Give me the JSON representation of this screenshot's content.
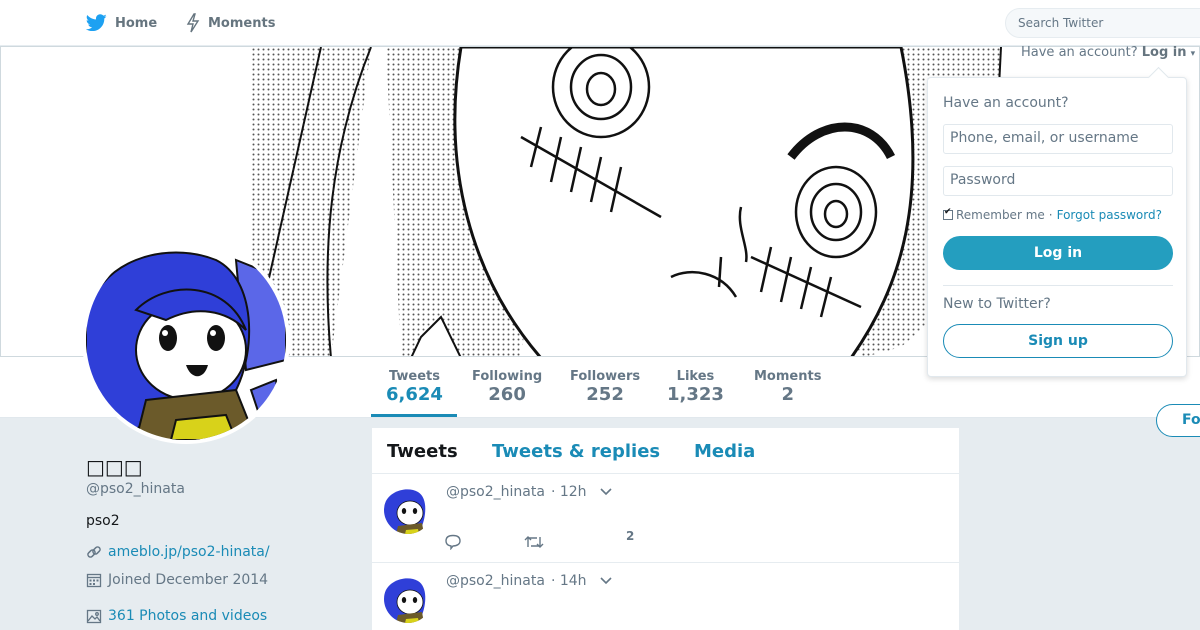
{
  "nav": {
    "home_label": "Home",
    "moments_label": "Moments",
    "search_placeholder": "Search Twitter"
  },
  "login": {
    "toggle_prefix": "Have an account?",
    "toggle_label": "Log in",
    "panel_title": "Have an account?",
    "username_placeholder": "Phone, email, or username",
    "password_placeholder": "Password",
    "remember_label": "Remember me",
    "separator": "·",
    "forgot_label": "Forgot password?",
    "login_button": "Log in",
    "new_prompt": "New to Twitter?",
    "signup_button": "Sign up"
  },
  "stats": [
    {
      "label": "Tweets",
      "value": "6,624",
      "active": true
    },
    {
      "label": "Following",
      "value": "260"
    },
    {
      "label": "Followers",
      "value": "252"
    },
    {
      "label": "Likes",
      "value": "1,323"
    },
    {
      "label": "Moments",
      "value": "2"
    }
  ],
  "follow_button": "Fo",
  "profile": {
    "name": "□□□",
    "handle": "@pso2_hinata",
    "bio": "pso2",
    "website": "ameblo.jp/pso2-hinata/",
    "joined": "Joined December 2014",
    "media": "361 Photos and videos"
  },
  "timeline": {
    "tabs": [
      "Tweets",
      "Tweets & replies",
      "Media"
    ],
    "tweets": [
      {
        "handle": "@pso2_hinata",
        "time": "· 12h",
        "like_count": "2"
      },
      {
        "handle": "@pso2_hinata",
        "time": "· 14h",
        "like_count": ""
      }
    ]
  },
  "colors": {
    "accent": "#1a8bb6",
    "background": "#e6ecf0",
    "hair": "#2f3fd8"
  },
  "icons": [
    "twitter-bird-icon",
    "lightning-icon",
    "link-icon",
    "calendar-icon",
    "image-icon",
    "reply-icon",
    "retweet-icon",
    "heart-icon",
    "chevron-down-icon"
  ]
}
